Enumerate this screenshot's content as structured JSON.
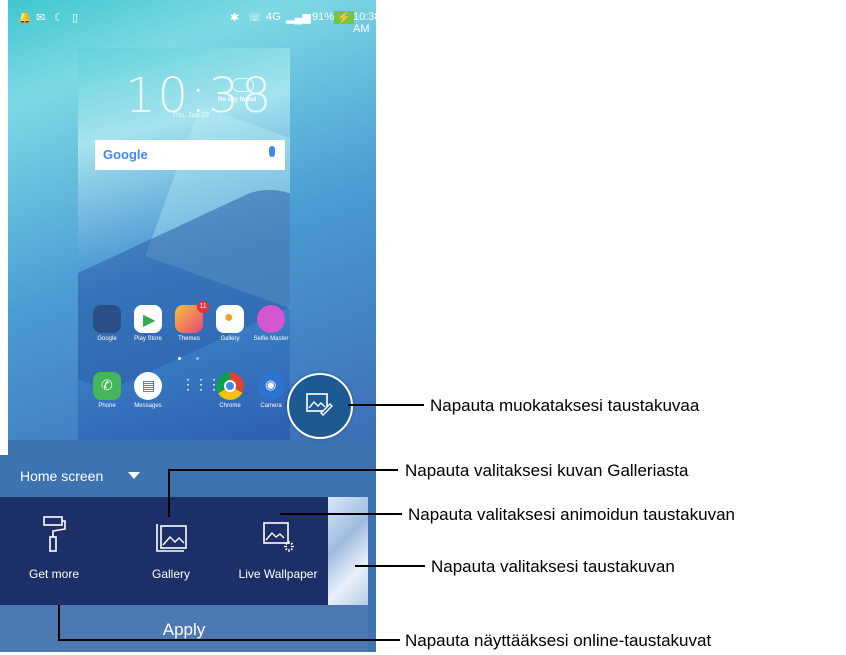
{
  "status_bar": {
    "battery": "91%",
    "time": "10:38 AM",
    "network": "4G"
  },
  "preview": {
    "clock": "10:38",
    "date": "Thu, Jun 29",
    "weather": "No city found",
    "search_logo": "Google",
    "apps_row1": [
      "Google",
      "Play Store",
      "Themes",
      "Gallery",
      "Selfie Master"
    ],
    "themes_badge": "11",
    "apps_row2": [
      "Phone",
      "Messages",
      "",
      "Chrome",
      "Camera"
    ]
  },
  "home_selector": "Home screen",
  "options": {
    "get_more": "Get more",
    "gallery": "Gallery",
    "live": "Live Wallpaper"
  },
  "apply": "Apply",
  "annotations": {
    "edit": "Napauta muokataksesi taustakuvaa",
    "gallery": "Napauta valitaksesi kuvan Galleriasta",
    "live": "Napauta valitaksesi animoidun taustakuvan",
    "thumb": "Napauta valitaksesi taustakuvan",
    "online": "Napauta näyttääksesi online-taustakuvat"
  },
  "colors": {
    "tray": "#1c2f66",
    "apply": "#4d79b3",
    "accent": "#1d5a92"
  }
}
